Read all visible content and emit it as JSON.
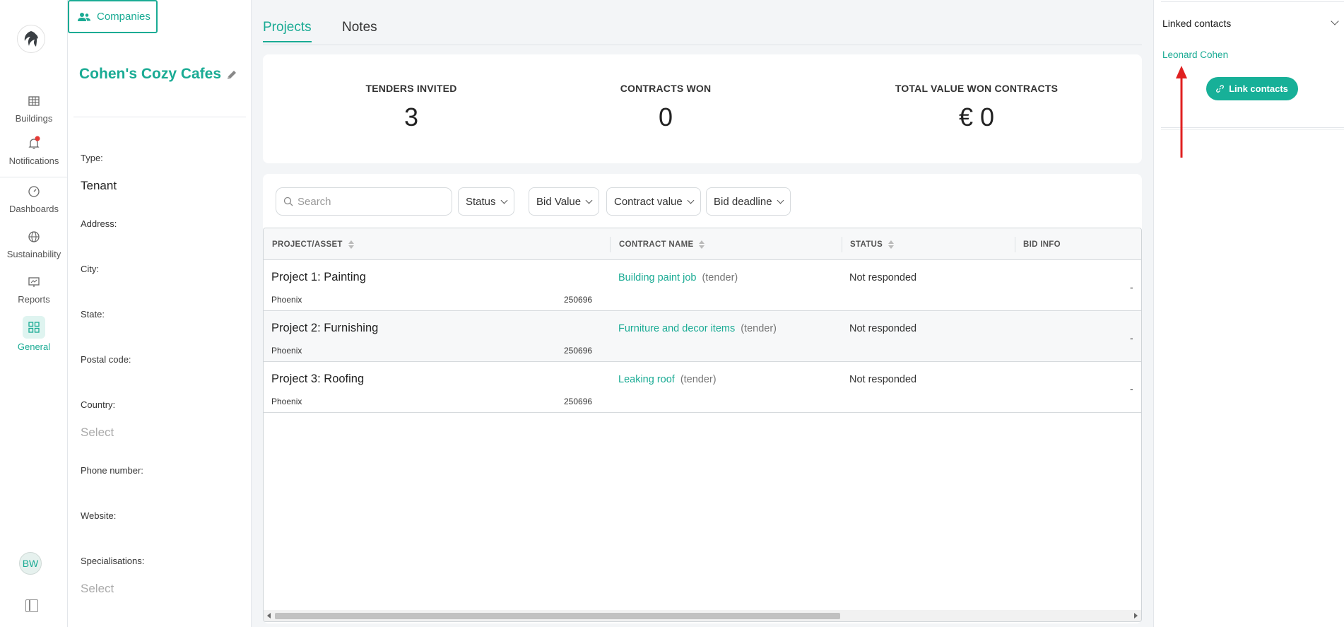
{
  "nav": {
    "items": [
      {
        "label": "Buildings",
        "icon": "buildings-icon"
      },
      {
        "label": "Notifications",
        "icon": "bell-icon"
      },
      {
        "label": "Dashboards",
        "icon": "gauge-icon"
      },
      {
        "label": "Sustainability",
        "icon": "globe-icon"
      },
      {
        "label": "Reports",
        "icon": "reports-icon"
      },
      {
        "label": "General",
        "icon": "grid-icon"
      }
    ],
    "avatar_initials": "BW"
  },
  "company": {
    "tab_label": "Companies",
    "name": "Cohen's Cozy Cafes",
    "fields": {
      "type_label": "Type:",
      "type_value": "Tenant",
      "address_label": "Address:",
      "city_label": "City:",
      "state_label": "State:",
      "postal_label": "Postal code:",
      "country_label": "Country:",
      "country_value": "Select",
      "phone_label": "Phone number:",
      "website_label": "Website:",
      "specialisations_label": "Specialisations:",
      "specialisations_value": "Select"
    }
  },
  "main": {
    "tabs": [
      {
        "label": "Projects"
      },
      {
        "label": "Notes"
      }
    ],
    "stats": [
      {
        "label": "TENDERS INVITED",
        "value": "3"
      },
      {
        "label": "CONTRACTS WON",
        "value": "0"
      },
      {
        "label": "TOTAL VALUE WON CONTRACTS",
        "value": "€ 0"
      }
    ],
    "search_placeholder": "Search",
    "filters": [
      "Status",
      "Bid Value",
      "Contract value",
      "Bid deadline"
    ],
    "columns": [
      "PROJECT/ASSET",
      "CONTRACT NAME",
      "STATUS",
      "BID INFO"
    ],
    "rows": [
      {
        "title": "Project 1: Painting",
        "city": "Phoenix",
        "code": "250696",
        "contract": "Building paint job",
        "contract_type": "(tender)",
        "status": "Not responded",
        "bid": "-"
      },
      {
        "title": "Project 2: Furnishing",
        "city": "Phoenix",
        "code": "250696",
        "contract": "Furniture and decor items",
        "contract_type": "(tender)",
        "status": "Not responded",
        "bid": "-"
      },
      {
        "title": "Project 3: Roofing",
        "city": "Phoenix",
        "code": "250696",
        "contract": "Leaking roof",
        "contract_type": "(tender)",
        "status": "Not responded",
        "bid": "-"
      }
    ]
  },
  "right_panel": {
    "title": "Linked contacts",
    "contact": "Leonard Cohen",
    "link_button": "Link contacts"
  },
  "colors": {
    "accent": "#1aab94",
    "annotation_arrow": "#e02020"
  }
}
